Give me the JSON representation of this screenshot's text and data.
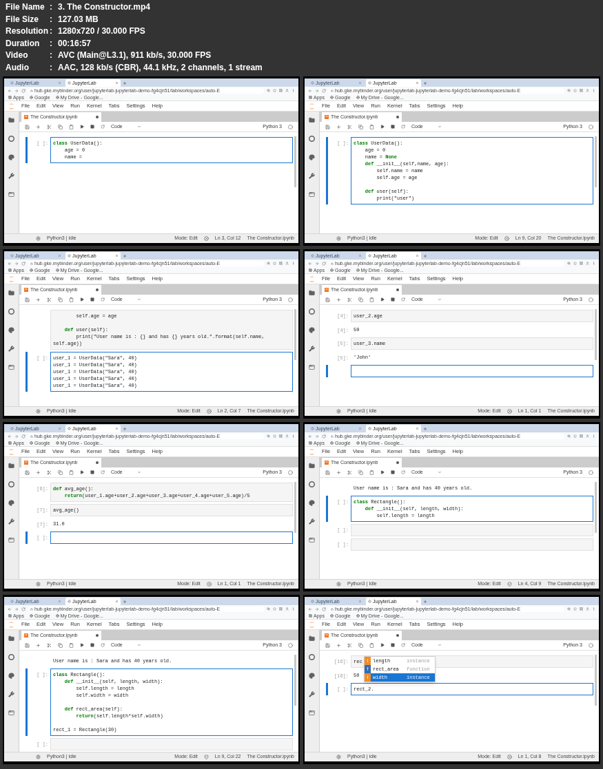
{
  "separator": ":",
  "info": [
    {
      "label": "File Name",
      "value": "3. The Constructor.mp4"
    },
    {
      "label": "File Size",
      "value": "127.03 MB"
    },
    {
      "label": "Resolution",
      "value": "1280x720 / 30.000 FPS"
    },
    {
      "label": "Duration",
      "value": "00:16:57"
    },
    {
      "label": "Video",
      "value": "AVC (Main@L3.1), 911 kb/s, 30.000 FPS"
    },
    {
      "label": "Audio",
      "value": "AAC, 128 kb/s (CBR), 44.1 kHz, 2 channels, 1 stream"
    }
  ],
  "frames": [
    {
      "browser_tabs": [
        {
          "label": "JupyterLab",
          "selected": false
        },
        {
          "label": "JupyterLab",
          "selected": true
        }
      ],
      "url": "hub.gke.mybinder.org/user/jupyterlab-jupyterlab-demo-fg4cjn51/lab/workspaces/auto-E",
      "bookmarks": [
        "Apps",
        "Google",
        "My Drive - Google..."
      ],
      "menu": [
        "File",
        "Edit",
        "View",
        "Run",
        "Kernel",
        "Tabs",
        "Settings",
        "Help"
      ],
      "doc_tab": "The Constructor.ipynb",
      "cell_type": "Code",
      "kernel_name": "Python 3",
      "cells": [
        {
          "kind": "input",
          "prompt": "[ ]:",
          "active": true,
          "code": "**class** UserData():\n    age = 0\n    name ="
        }
      ],
      "status": {
        "kernel": "Python3 | Idle",
        "mode": "Mode: Edit",
        "lint_ok": false,
        "position": "Ln 3, Col 12",
        "file": "The Constructor.ipynb"
      }
    },
    {
      "browser_tabs": [
        {
          "label": "JupyterLab",
          "selected": false
        },
        {
          "label": "JupyterLab",
          "selected": true
        }
      ],
      "url": "hub.gke.mybinder.org/user/jupyterlab-jupyterlab-demo-fg4cjn51/lab/workspaces/auto-E",
      "bookmarks": [
        "Apps",
        "Google",
        "My Drive - Google..."
      ],
      "menu": [
        "File",
        "Edit",
        "View",
        "Run",
        "Kernel",
        "Tabs",
        "Settings",
        "Help"
      ],
      "doc_tab": "The Constructor.ipynb",
      "cell_type": "Code",
      "kernel_name": "Python 3",
      "cells": [
        {
          "kind": "input",
          "prompt": "[ ]:",
          "active": true,
          "code": "**class** UserData():\n    age = 0\n    name = **None**\n    **def** __init__(self,name, age):\n        self.name = name\n        self.age = age\n\n    **def** user(self):\n        print(\"user\")"
        }
      ],
      "status": {
        "kernel": "Python3 | Idle",
        "mode": "Mode: Edit",
        "lint_ok": false,
        "position": "Ln 9, Col 20",
        "file": "The Constructor.ipynb"
      }
    },
    {
      "browser_tabs": [
        {
          "label": "JupyterLab",
          "selected": false
        },
        {
          "label": "JupyterLab",
          "selected": true
        }
      ],
      "url": "hub.gke.mybinder.org/user/jupyterlab-jupyterlab-demo-fg4cjn51/lab/workspaces/auto-E",
      "bookmarks": [
        "Apps",
        "Google",
        "My Drive - Google..."
      ],
      "menu": [
        "File",
        "Edit",
        "View",
        "Run",
        "Kernel",
        "Tabs",
        "Settings",
        "Help"
      ],
      "doc_tab": "The Constructor.ipynb",
      "cell_type": "Code",
      "kernel_name": "Python 3",
      "cells": [
        {
          "kind": "input",
          "active": false,
          "code": "        self.age = age\n\n    **def** user(self):\n        print(\"User name is : {} and has {} years old.\".format(self.name, self.age))"
        },
        {
          "kind": "input",
          "prompt": "[ ]:",
          "active": true,
          "code": "user_1 = UserData(\"Sara\", 40)\nuser_1 = UserData(\"Sara\", 40)\nuser_1 = UserData(\"Sara\", 40)\nuser_1 = UserData(\"Sara\", 40)\nuser_1 = UserData(\"Sara\", 40)"
        }
      ],
      "status": {
        "kernel": "Python3 | Idle",
        "mode": "Mode: Edit",
        "lint_ok": false,
        "position": "Ln 2, Col 7",
        "file": "The Constructor.ipynb"
      }
    },
    {
      "browser_tabs": [
        {
          "label": "JupyterLab",
          "selected": false
        },
        {
          "label": "JupyterLab",
          "selected": true
        }
      ],
      "url": "hub.gke.mybinder.org/user/jupyterlab-jupyterlab-demo-fg4cjn51/lab/workspaces/auto-E",
      "bookmarks": [
        "Apps",
        "Google",
        "My Drive - Google..."
      ],
      "menu": [
        "File",
        "Edit",
        "View",
        "Run",
        "Kernel",
        "Tabs",
        "Settings",
        "Help"
      ],
      "doc_tab": "The Constructor.ipynb",
      "cell_type": "Code",
      "kernel_name": "Python 3",
      "cells": [
        {
          "kind": "input",
          "prompt": "[4]:",
          "active": false,
          "code": "user_2.age"
        },
        {
          "kind": "output",
          "prompt": "[4]:",
          "active": false,
          "code": "50"
        },
        {
          "kind": "input",
          "prompt": "[5]:",
          "active": false,
          "code": "user_3.name"
        },
        {
          "kind": "output",
          "prompt": "[5]:",
          "active": false,
          "code": "'John'"
        },
        {
          "kind": "input",
          "active": true
        }
      ],
      "status": {
        "kernel": "Python3 | Idle",
        "mode": "Mode: Edit",
        "lint_ok": false,
        "position": "Ln 1, Col 1",
        "file": "The Constructor.ipynb"
      }
    },
    {
      "browser_tabs": [
        {
          "label": "JupyterLab",
          "selected": false
        },
        {
          "label": "JupyterLab",
          "selected": true
        }
      ],
      "url": "hub.gke.mybinder.org/user/jupyterlab-jupyterlab-demo-fg4cjn51/lab/workspaces/auto-E",
      "bookmarks": [
        "Apps",
        "Google",
        "My Drive - Google..."
      ],
      "menu": [
        "File",
        "Edit",
        "View",
        "Run",
        "Kernel",
        "Tabs",
        "Settings",
        "Help"
      ],
      "doc_tab": "The Constructor.ipynb",
      "cell_type": "Code",
      "kernel_name": "Python 3",
      "cells": [
        {
          "kind": "input",
          "prompt": "[6]:",
          "active": false,
          "code": "**def** avg_age():\n    **return**(user_1.age+user_2.age+user_3.age+user_4.age+user_5.age)/5"
        },
        {
          "kind": "input",
          "prompt": "[7]:",
          "active": false,
          "code": "avg_age()"
        },
        {
          "kind": "output",
          "prompt": "[7]:",
          "active": false,
          "code": "31.0"
        },
        {
          "kind": "input",
          "prompt": "[ ]:",
          "active": true
        }
      ],
      "status": {
        "kernel": "Python3 | Idle",
        "mode": "Mode: Edit",
        "lint_ok": false,
        "position": "Ln 1, Col 1",
        "file": "The Constructor.ipynb"
      }
    },
    {
      "browser_tabs": [
        {
          "label": "JupyterLab",
          "selected": false
        },
        {
          "label": "JupyterLab",
          "selected": true
        }
      ],
      "url": "hub.gke.mybinder.org/user/jupyterlab-jupyterlab-demo-fg4cjn51/lab/workspaces/auto-E",
      "bookmarks": [
        "Apps",
        "Google",
        "My Drive - Google..."
      ],
      "menu": [
        "File",
        "Edit",
        "View",
        "Run",
        "Kernel",
        "Tabs",
        "Settings",
        "Help"
      ],
      "doc_tab": "The Constructor.ipynb",
      "cell_type": "Code",
      "kernel_name": "Python 3",
      "cells": [
        {
          "kind": "output",
          "active": false,
          "code": "User name is : Sara and has 40 years old."
        },
        {
          "kind": "input",
          "prompt": "[ ]:",
          "active": true,
          "code": "**class** Rectangle():\n    **def** __init__(self, length, width):\n        self.length = length\n"
        },
        {
          "kind": "input",
          "prompt": "[ ]:",
          "active": false
        },
        {
          "kind": "input",
          "prompt": "[ ]:",
          "active": false
        }
      ],
      "status": {
        "kernel": "Python3 | Idle",
        "mode": "Mode: Edit",
        "lint_ok": true,
        "position": "Ln 4, Col 9",
        "file": "The Constructor.ipynb"
      }
    },
    {
      "browser_tabs": [
        {
          "label": "JupyterLab",
          "selected": false
        },
        {
          "label": "JupyterLab",
          "selected": true
        }
      ],
      "url": "hub.gke.mybinder.org/user/jupyterlab-jupyterlab-demo-fg4cjn51/lab/workspaces/auto-E",
      "bookmarks": [
        "Apps",
        "Google",
        "My Drive - Google..."
      ],
      "menu": [
        "File",
        "Edit",
        "View",
        "Run",
        "Kernel",
        "Tabs",
        "Settings",
        "Help"
      ],
      "doc_tab": "The Constructor.ipynb",
      "cell_type": "Code",
      "kernel_name": "Python 3",
      "cells": [
        {
          "kind": "output",
          "active": false,
          "code": "User name is : Sara and has 40 years old."
        },
        {
          "kind": "input",
          "prompt": "[ ]:",
          "active": true,
          "code": "**class** Rectangle():\n    **def** __init__(self, length, width):\n        self.length = length\n        self.width = width\n\n    **def** rect_area(self):\n        **return**(self.length*self.width)\n\nrect_1 = Rectangle(30)"
        },
        {
          "kind": "input",
          "prompt": "[ ]:",
          "active": false
        }
      ],
      "status": {
        "kernel": "Python3 | Idle",
        "mode": "Mode: Edit",
        "lint_ok": true,
        "position": "Ln 9, Col 22",
        "file": "The Constructor.ipynb"
      }
    },
    {
      "browser_tabs": [
        {
          "label": "JupyterLab",
          "selected": false
        },
        {
          "label": "JupyterLab",
          "selected": true
        }
      ],
      "url": "hub.gke.mybinder.org/user/jupyterlab-jupyterlab-demo-fg4cjn51/lab/workspaces/auto-E",
      "bookmarks": [
        "Apps",
        "Google",
        "My Drive - Google..."
      ],
      "menu": [
        "File",
        "Edit",
        "View",
        "Run",
        "Kernel",
        "Tabs",
        "Settings",
        "Help"
      ],
      "doc_tab": "The Constructor.ipynb",
      "cell_type": "Code",
      "kernel_name": "Python 3",
      "cells": [
        {
          "kind": "input",
          "prompt": "[16]:",
          "active": false,
          "code": "rec"
        },
        {
          "kind": "output",
          "prompt": "[16]:",
          "active": false,
          "code": "50"
        },
        {
          "kind": "input",
          "prompt": "[ ]:",
          "active": true,
          "code": "rect_2."
        }
      ],
      "completion": [
        {
          "type": "i",
          "label": "length",
          "detail": "instance",
          "color": "#f28c28",
          "selected": false
        },
        {
          "type": "f",
          "label": "rect_area",
          "detail": "function",
          "color": "#2f6db5",
          "selected": false
        },
        {
          "type": "i",
          "label": "width",
          "detail": "instance",
          "color": "#f28c28",
          "selected": true
        }
      ],
      "status": {
        "kernel": "Python3 | Idle",
        "mode": "Mode: Edit",
        "lint_ok": false,
        "position": "Ln 1, Col 8",
        "file": "The Constructor.ipynb"
      }
    }
  ]
}
